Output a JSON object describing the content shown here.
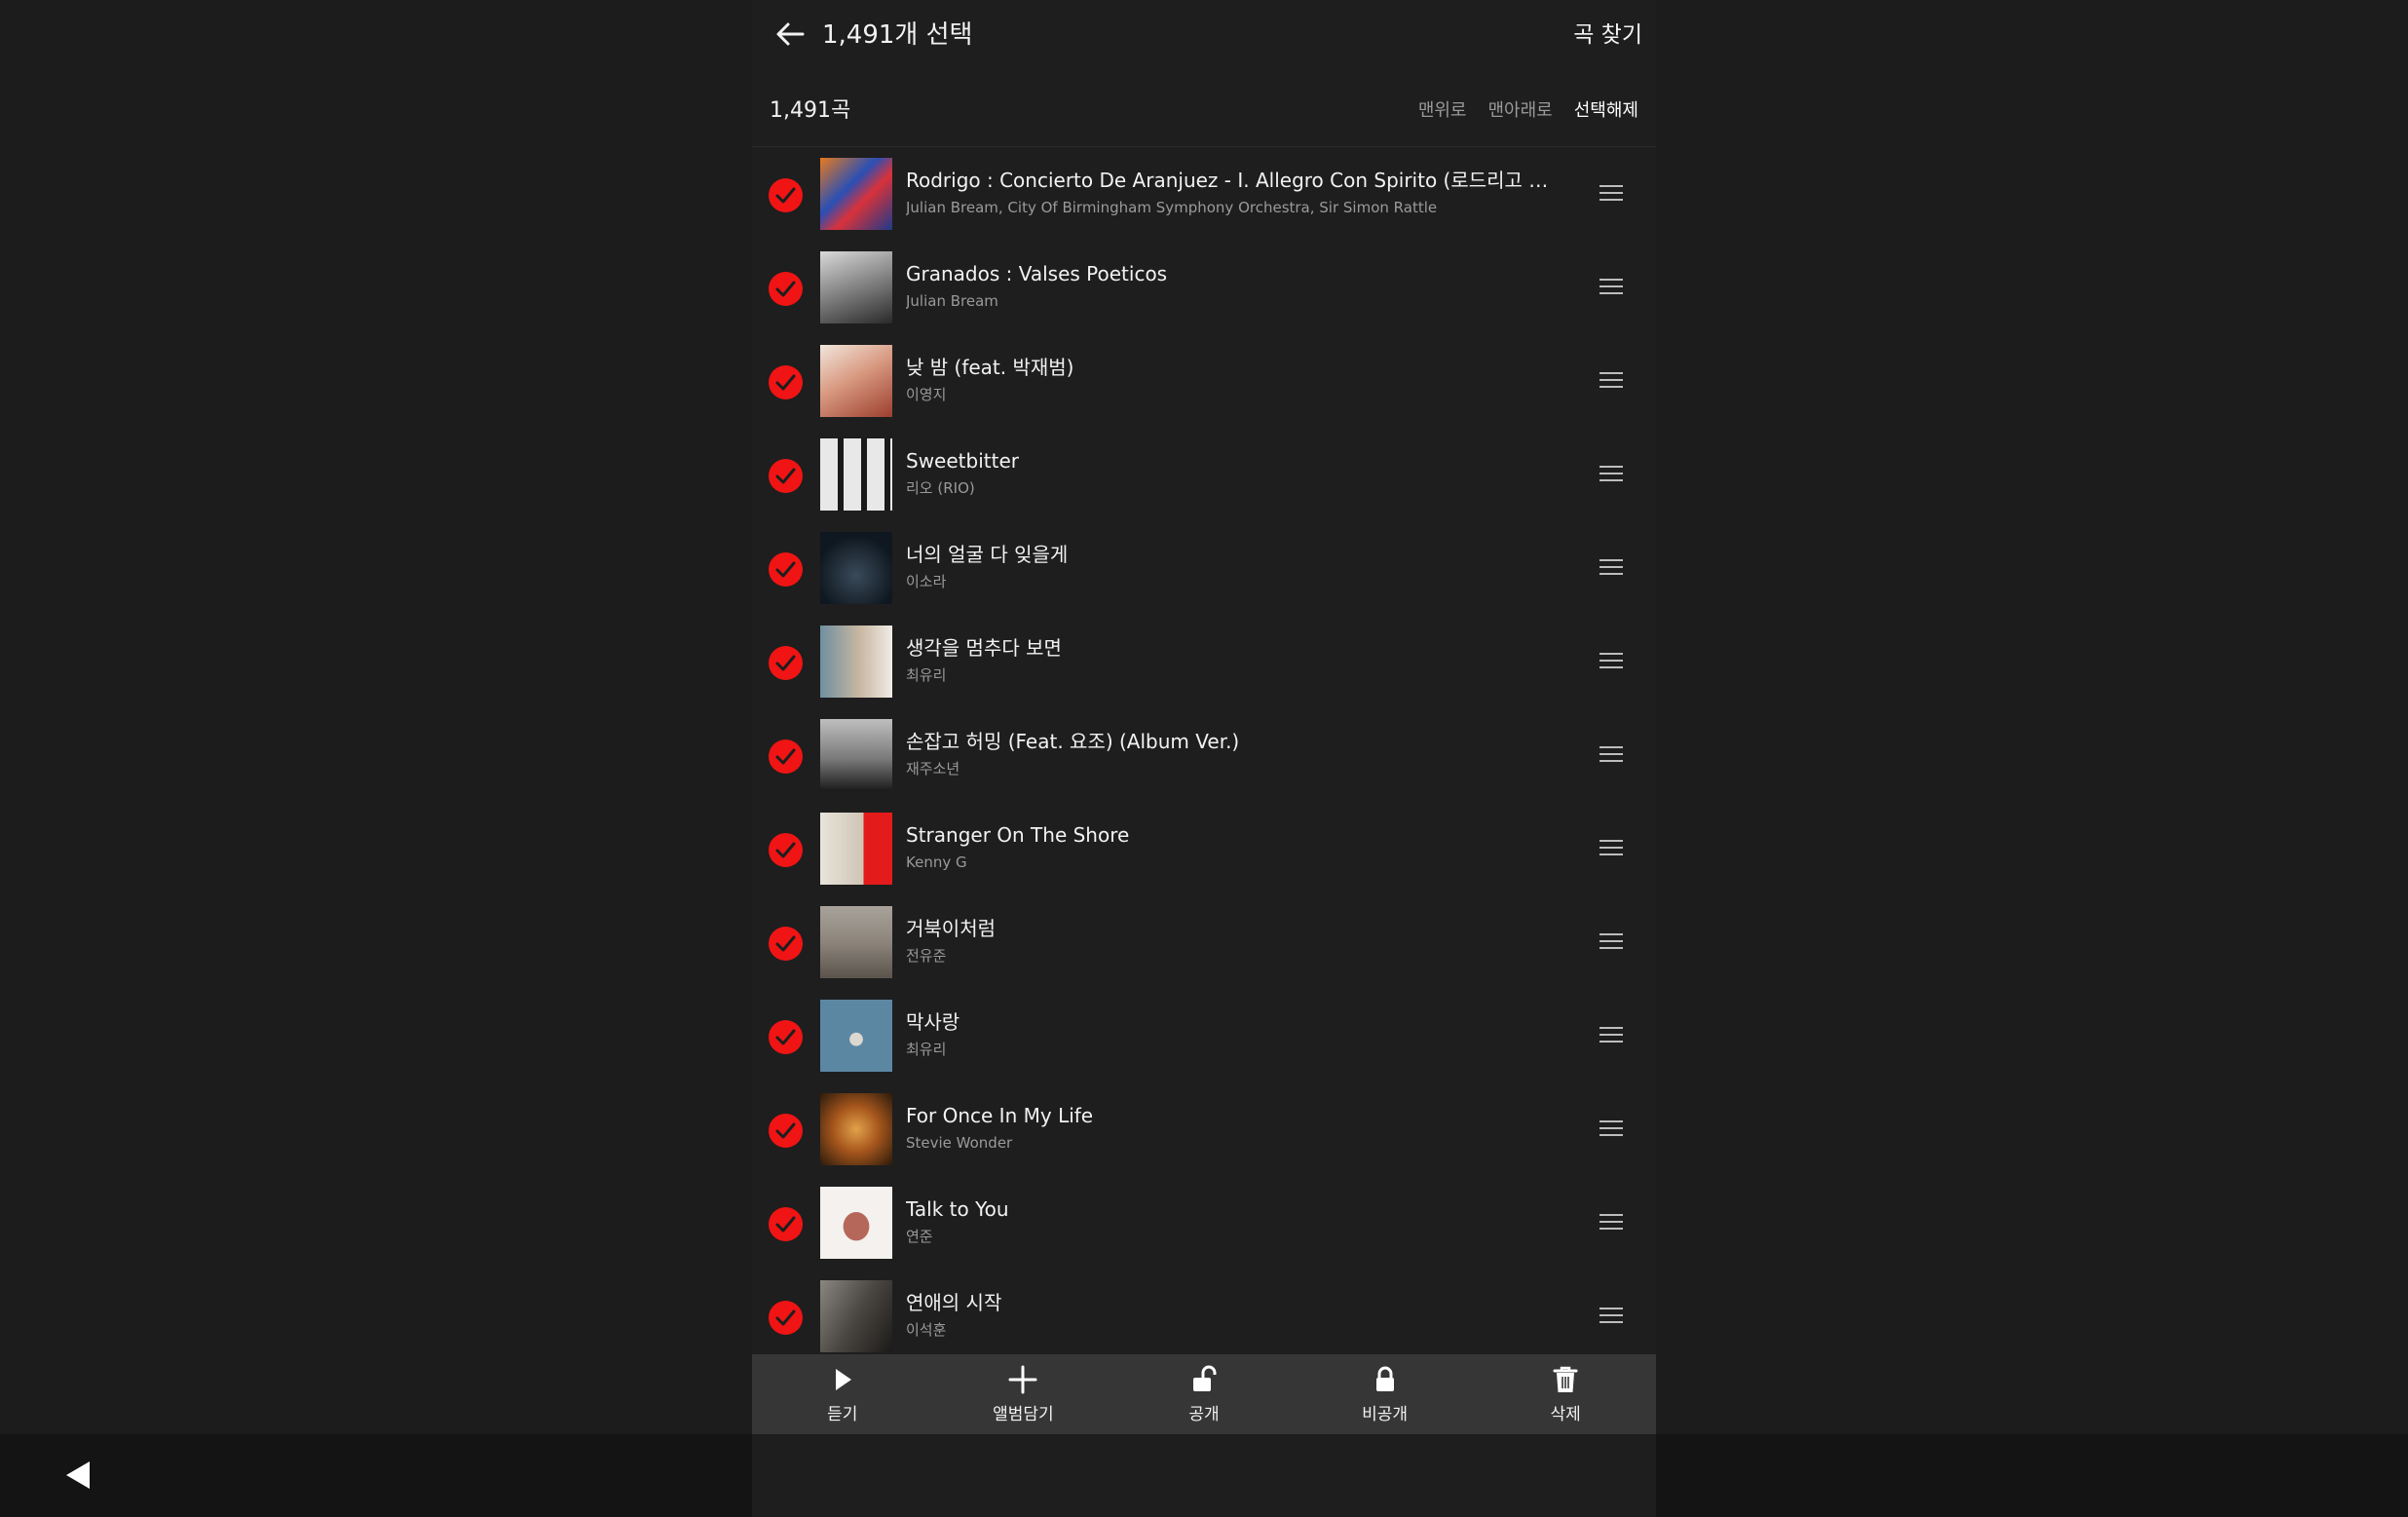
{
  "header": {
    "title": "1,491개 선택",
    "find_song": "곡 찾기"
  },
  "subheader": {
    "count": "1,491곡",
    "to_top": "맨위로",
    "to_bottom": "맨아래로",
    "deselect": "선택해제"
  },
  "songs": [
    {
      "title": "Rodrigo : Concierto De Aranjuez - I. Allegro Con Spirito (로드리고 : 아랑...",
      "artist": "Julian Bream, City Of Birmingham Symphony Orchestra, Sir Simon Rattle",
      "selected": true
    },
    {
      "title": "Granados : Valses Poeticos",
      "artist": "Julian Bream",
      "selected": true
    },
    {
      "title": "낮 밤 (feat. 박재범)",
      "artist": "이영지",
      "selected": true
    },
    {
      "title": "Sweetbitter",
      "artist": "리오 (RIO)",
      "selected": true
    },
    {
      "title": "너의 얼굴 다 잊을게",
      "artist": "이소라",
      "selected": true
    },
    {
      "title": "생각을 멈추다 보면",
      "artist": "최유리",
      "selected": true
    },
    {
      "title": "손잡고 허밍 (Feat. 요조) (Album Ver.)",
      "artist": "재주소년",
      "selected": true
    },
    {
      "title": "Stranger On The Shore",
      "artist": "Kenny G",
      "selected": true
    },
    {
      "title": "거북이처럼",
      "artist": "전유준",
      "selected": true
    },
    {
      "title": "막사랑",
      "artist": "최유리",
      "selected": true
    },
    {
      "title": "For Once In My Life",
      "artist": "Stevie Wonder",
      "selected": true
    },
    {
      "title": "Talk to You",
      "artist": "연준",
      "selected": true
    },
    {
      "title": "연애의 시작",
      "artist": "이석훈",
      "selected": true
    }
  ],
  "bottom_bar": {
    "play": "듣기",
    "add_album": "앨범담기",
    "public": "공개",
    "private": "비공개",
    "delete": "삭제"
  },
  "colors": {
    "accent": "#f01414",
    "background": "#1e1e1e",
    "bottom_bar": "#363636"
  },
  "icons": {
    "back": "arrow-left-icon",
    "check": "check-circle-icon",
    "drag": "drag-handle-icon",
    "play": "play-icon",
    "add": "plus-icon",
    "unlock": "unlock-icon",
    "lock": "lock-icon",
    "trash": "trash-icon"
  }
}
